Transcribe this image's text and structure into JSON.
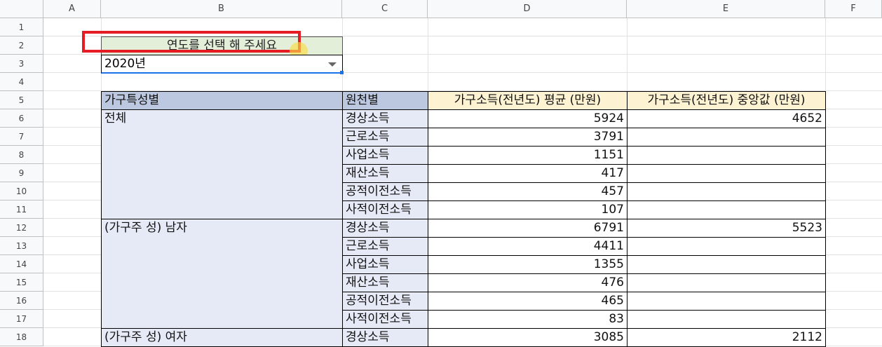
{
  "columns": [
    "A",
    "B",
    "C",
    "D",
    "E",
    "F"
  ],
  "rows": [
    "1",
    "2",
    "3",
    "4",
    "5",
    "6",
    "7",
    "8",
    "9",
    "10",
    "11",
    "12",
    "13",
    "14",
    "15",
    "16",
    "17",
    "18"
  ],
  "prompt_label": "연도를 선택 해 주세요",
  "year_select": {
    "value": "2020년"
  },
  "table": {
    "headers": {
      "category": "가구특성별",
      "source": "원천별",
      "mean": "가구소득(전년도) 평균 (만원)",
      "median": "가구소득(전년도) 중앙값 (만원)"
    },
    "groups": [
      {
        "label": "전체",
        "median": "4652",
        "items": [
          {
            "source": "경상소득",
            "mean": "5924"
          },
          {
            "source": "근로소득",
            "mean": "3791"
          },
          {
            "source": "사업소득",
            "mean": "1151"
          },
          {
            "source": "재산소득",
            "mean": "417"
          },
          {
            "source": "공적이전소득",
            "mean": "457"
          },
          {
            "source": "사적이전소득",
            "mean": "107"
          }
        ]
      },
      {
        "label": "(가구주 성) 남자",
        "median": "5523",
        "items": [
          {
            "source": "경상소득",
            "mean": "6791"
          },
          {
            "source": "근로소득",
            "mean": "4411"
          },
          {
            "source": "사업소득",
            "mean": "1355"
          },
          {
            "source": "재산소득",
            "mean": "476"
          },
          {
            "source": "공적이전소득",
            "mean": "465"
          },
          {
            "source": "사적이전소득",
            "mean": "83"
          }
        ]
      },
      {
        "label": "(가구주 성) 여자",
        "median": "2112",
        "items": [
          {
            "source": "경상소득",
            "mean": "3085"
          }
        ]
      }
    ]
  },
  "accent_color": "#1a73e8",
  "highlight_color": "#e51c23"
}
